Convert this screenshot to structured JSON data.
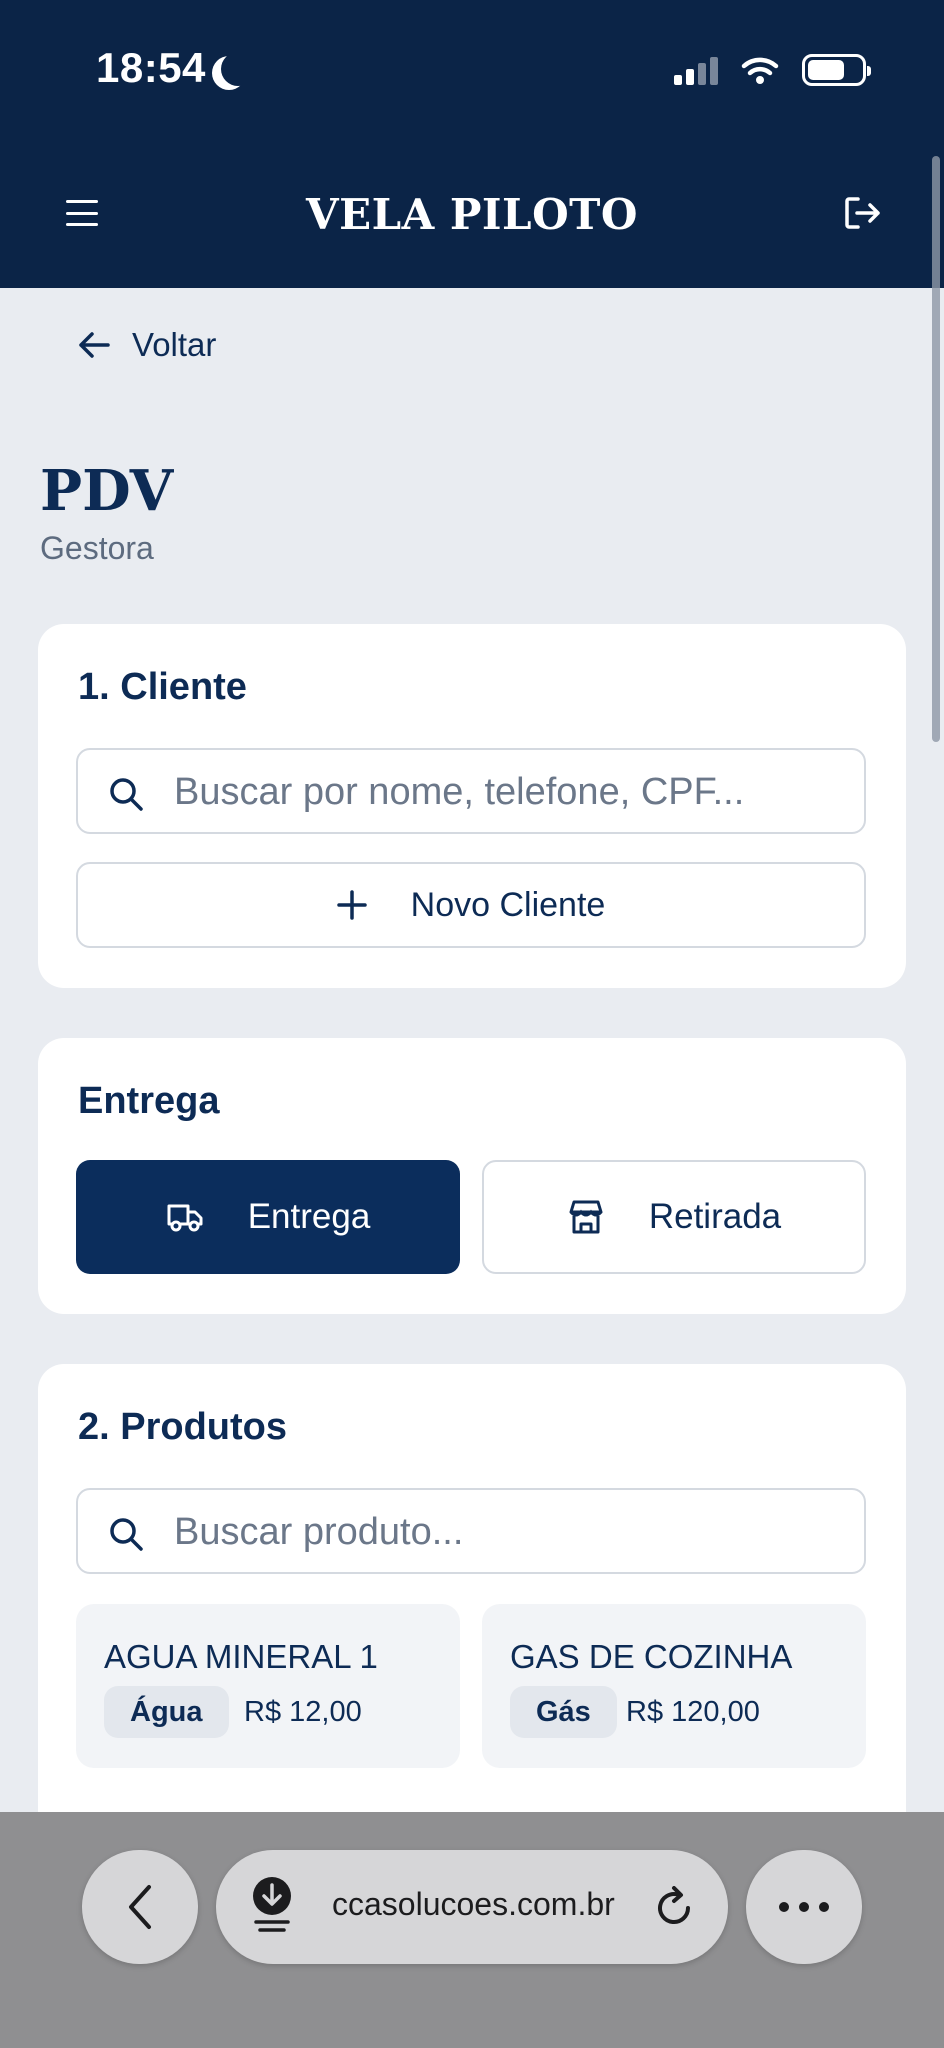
{
  "status": {
    "time": "18:54"
  },
  "header": {
    "title": "VELA PILOTO"
  },
  "nav": {
    "back_label": "Voltar"
  },
  "page": {
    "title": "PDV",
    "subtitle": "Gestora"
  },
  "cliente": {
    "title": "1. Cliente",
    "search_placeholder": "Buscar por nome, telefone, CPF...",
    "new_label": "Novo Cliente"
  },
  "entrega": {
    "title": "Entrega",
    "options": [
      {
        "label": "Entrega",
        "icon": "truck-icon",
        "selected": true
      },
      {
        "label": "Retirada",
        "icon": "store-icon",
        "selected": false
      }
    ]
  },
  "produtos": {
    "title": "2. Produtos",
    "search_placeholder": "Buscar produto...",
    "items": [
      {
        "name": "AGUA MINERAL 1",
        "category": "Água",
        "price": "R$ 12,00"
      },
      {
        "name": "GAS DE COZINHA",
        "category": "Gás",
        "price": "R$ 120,00"
      }
    ]
  },
  "browser": {
    "url": "ccasolucoes.com.br"
  },
  "colors": {
    "primary": "#0b2447",
    "accent": "#0b2d5c",
    "background": "#e9ecf1"
  }
}
